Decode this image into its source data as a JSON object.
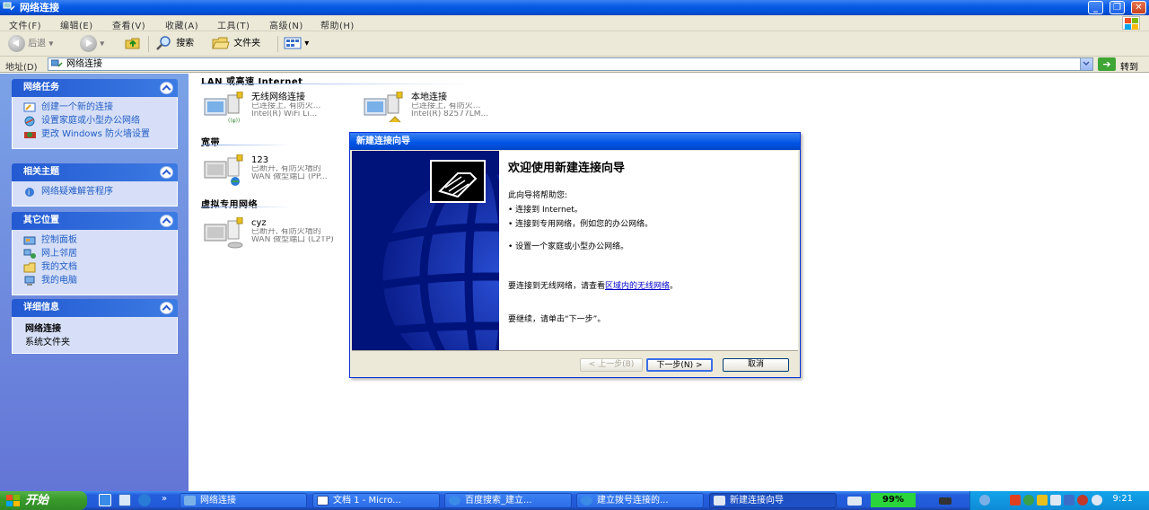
{
  "window": {
    "title": "网络连接"
  },
  "menu": [
    "文件(F)",
    "编辑(E)",
    "查看(V)",
    "收藏(A)",
    "工具(T)",
    "高级(N)",
    "帮助(H)"
  ],
  "toolbar": {
    "back": "后退",
    "search": "搜索",
    "folders": "文件夹"
  },
  "address": {
    "label": "地址(D)",
    "value": "网络连接",
    "go": "转到"
  },
  "sidebar": {
    "network_tasks": {
      "title": "网络任务",
      "items": [
        "创建一个新的连接",
        "设置家庭或小型办公网络",
        "更改 Windows 防火墙设置"
      ]
    },
    "related": {
      "title": "相关主题",
      "items": [
        "网络疑难解答程序"
      ]
    },
    "other_places": {
      "title": "其它位置",
      "items": [
        "控制面板",
        "网上邻居",
        "我的文档",
        "我的电脑"
      ]
    },
    "details": {
      "title": "详细信息",
      "name": "网络连接",
      "type": "系统文件夹"
    }
  },
  "groups": {
    "lan": {
      "title": "LAN 或高速 Internet",
      "items": [
        {
          "name": "无线网络连接",
          "status": "已连接上, 有防火...",
          "device": "Intel(R) WiFi Li..."
        },
        {
          "name": "本地连接",
          "status": "已连接上, 有防火...",
          "device": "Intel(R) 82577LM..."
        }
      ]
    },
    "broadband": {
      "title": "宽带",
      "items": [
        {
          "name": "123",
          "status": "已断开, 有防火墙的",
          "device": "WAN 微型端口 (PP..."
        }
      ]
    },
    "vpn": {
      "title": "虚拟专用网络",
      "items": [
        {
          "name": "cyz",
          "status": "已断开, 有防火墙的",
          "device": "WAN 微型端口 (L2TP)"
        }
      ]
    }
  },
  "wizard": {
    "title": "新建连接向导",
    "heading": "欢迎使用新建连接向导",
    "intro": "此向导将帮助您:",
    "bullet1": "• 连接到 Internet。",
    "bullet2": "• 连接到专用网络，例如您的办公网络。",
    "bullet3": "• 设置一个家庭或小型办公网络。",
    "wireless_prefix": "要连接到无线网络，请查看",
    "wireless_link": "区域内的无线网络",
    "wireless_suffix": "。",
    "continue": "要继续，请单击“下一步”。",
    "btn_back": "< 上一步(B)",
    "btn_next": "下一步(N) >",
    "btn_cancel": "取消"
  },
  "taskbar": {
    "start": "开始",
    "buttons": [
      "网络连接",
      "文档 1 - Micro...",
      "百度搜索_建立...",
      "建立拨号连接的...",
      "新建连接向导"
    ],
    "battery": "99%",
    "clock": "9:21"
  },
  "colors": {
    "xp_blue": "#0055e5",
    "sidebar": "#6f8ee0",
    "start_green": "#3a9c2c",
    "link": "#215dc6"
  }
}
